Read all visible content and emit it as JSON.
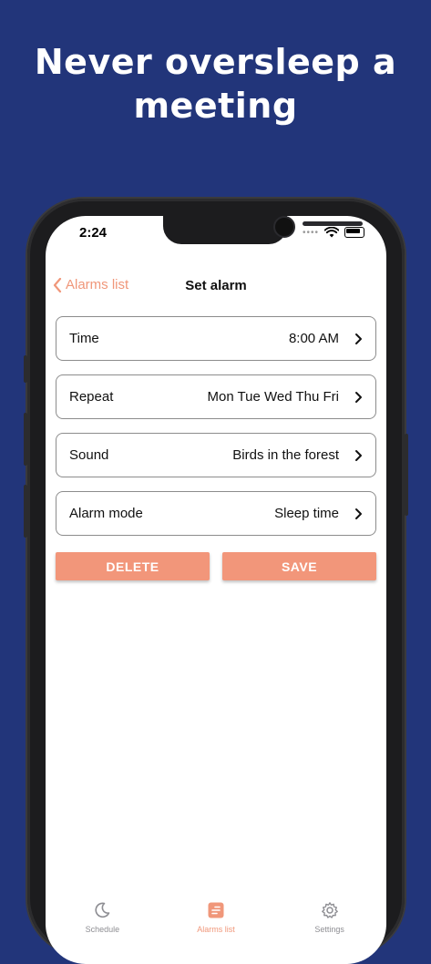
{
  "headline": "Never oversleep a meeting",
  "status_bar": {
    "time": "2:24"
  },
  "navbar": {
    "back_label": "Alarms list",
    "title": "Set alarm"
  },
  "rows": [
    {
      "label": "Time",
      "value": "8:00 AM"
    },
    {
      "label": "Repeat",
      "value": "Mon Tue Wed Thu Fri"
    },
    {
      "label": "Sound",
      "value": "Birds in the forest"
    },
    {
      "label": "Alarm mode",
      "value": "Sleep time"
    }
  ],
  "actions": {
    "delete_label": "DELETE",
    "save_label": "SAVE"
  },
  "tabs": [
    {
      "label": "Schedule",
      "icon": "moon-icon",
      "active": false
    },
    {
      "label": "Alarms list",
      "icon": "list-icon",
      "active": true
    },
    {
      "label": "Settings",
      "icon": "gear-icon",
      "active": false
    }
  ],
  "colors": {
    "background": "#22357a",
    "accent": "#f2967a"
  }
}
